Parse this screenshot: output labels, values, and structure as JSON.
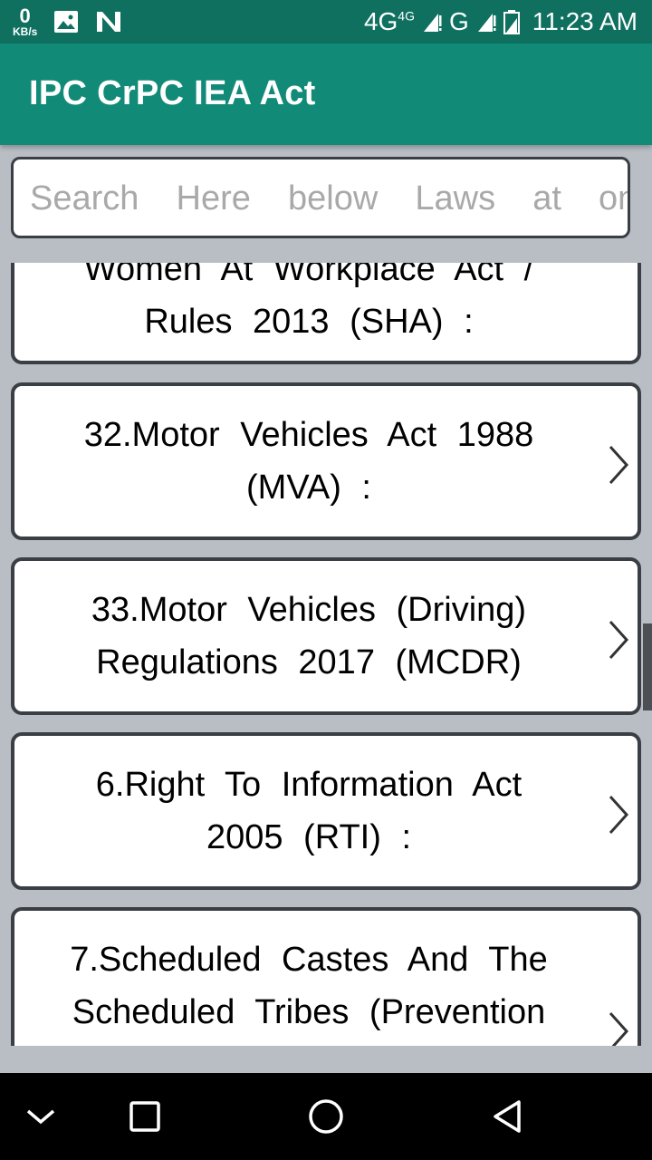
{
  "status_bar": {
    "data_rate": "0",
    "data_unit": "KB/s",
    "network_primary": "4G",
    "network_primary_super": "4G",
    "network_secondary": "G",
    "time": "11:23 AM"
  },
  "app_bar": {
    "title": "IPC CrPC IEA Act"
  },
  "search": {
    "placeholder": "Search  Here  below  Laws  at  one  p"
  },
  "list": {
    "items": [
      {
        "partial_top": "Women  At  Workplace  Act  /",
        "label": "Rules  2013  (SHA)  :"
      },
      {
        "label1": "32.Motor  Vehicles  Act  1988",
        "label2": "(MVA)  :"
      },
      {
        "label1": "33.Motor  Vehicles  (Driving)",
        "label2": "Regulations  2017  (MCDR)"
      },
      {
        "label1": "6.Right  To  Information  Act",
        "label2": "2005  (RTI)  :"
      },
      {
        "label1": "7.Scheduled  Castes  And  The",
        "label2": "Scheduled  Tribes  (Prevention"
      }
    ]
  },
  "icons": {
    "chevron": "chevron-right-icon",
    "nav_back": "back-icon",
    "nav_home": "home-icon",
    "nav_recents": "recents-icon",
    "nav_collapse": "collapse-icon"
  },
  "colors": {
    "status_bar": "#0f7060",
    "app_bar": "#128a78",
    "list_background": "#b9bec5",
    "card_border": "#3a3f45"
  }
}
